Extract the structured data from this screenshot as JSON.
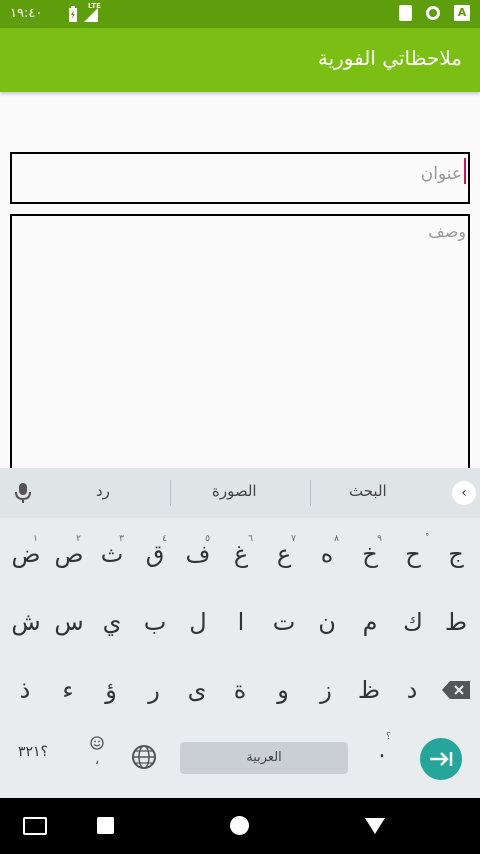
{
  "status_bar": {
    "time": "١٩:٤٠",
    "network": "LTE",
    "indicator": "A",
    "icons": [
      "battery-charging-icon",
      "signal-icon",
      "sd-card-icon",
      "sync-icon",
      "a-icon"
    ]
  },
  "app_bar": {
    "title": "ملاحظاتي الفورية",
    "color": "#7cbf14",
    "status_color": "#5e9e0c"
  },
  "form": {
    "title_placeholder": "عنوان",
    "description_placeholder": "وصف",
    "cursor_color": "#c2185b"
  },
  "keyboard": {
    "suggestions": [
      "البحث",
      "الصورة",
      "رد"
    ],
    "rows": [
      [
        {
          "char": "ج",
          "hint": ""
        },
        {
          "char": "ح",
          "hint": "ْ"
        },
        {
          "char": "خ",
          "hint": "٩"
        },
        {
          "char": "ه",
          "hint": "٨"
        },
        {
          "char": "ع",
          "hint": "٧"
        },
        {
          "char": "غ",
          "hint": "٦"
        },
        {
          "char": "ف",
          "hint": "٥"
        },
        {
          "char": "ق",
          "hint": "٤"
        },
        {
          "char": "ث",
          "hint": "٣"
        },
        {
          "char": "ص",
          "hint": "٢"
        },
        {
          "char": "ض",
          "hint": "١"
        }
      ],
      [
        {
          "char": "ط",
          "hint": ""
        },
        {
          "char": "ك",
          "hint": ""
        },
        {
          "char": "م",
          "hint": ""
        },
        {
          "char": "ن",
          "hint": ""
        },
        {
          "char": "ت",
          "hint": ""
        },
        {
          "char": "ا",
          "hint": ""
        },
        {
          "char": "ل",
          "hint": ""
        },
        {
          "char": "ب",
          "hint": ""
        },
        {
          "char": "ي",
          "hint": ""
        },
        {
          "char": "س",
          "hint": ""
        },
        {
          "char": "ش",
          "hint": ""
        }
      ],
      [
        {
          "char": "د",
          "hint": ""
        },
        {
          "char": "ظ",
          "hint": ""
        },
        {
          "char": "ز",
          "hint": ""
        },
        {
          "char": "و",
          "hint": ""
        },
        {
          "char": "ة",
          "hint": ""
        },
        {
          "char": "ى",
          "hint": ""
        },
        {
          "char": "ر",
          "hint": ""
        },
        {
          "char": "ؤ",
          "hint": ""
        },
        {
          "char": "ء",
          "hint": ""
        },
        {
          "char": "ذ",
          "hint": ""
        }
      ]
    ],
    "symbols_label": "؟٣٢١",
    "emoji_comma": "،",
    "space_label": "العربية",
    "period_label": ".",
    "period_hint": "؟",
    "enter_color": "#26a69a"
  },
  "nav_bar": {
    "icons": [
      "keyboard-switch-icon",
      "recents-icon",
      "home-icon",
      "back-icon"
    ]
  }
}
